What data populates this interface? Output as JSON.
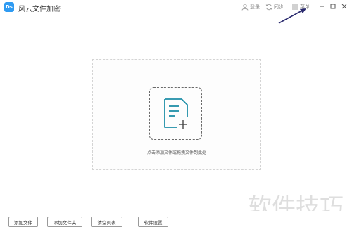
{
  "app": {
    "title": "风云文件加密",
    "logo_text": "Ds"
  },
  "titlebar": {
    "login_label": "登录",
    "sync_label": "同步",
    "menu_label": "菜单"
  },
  "main": {
    "drop_hint": "点击添加文件或拖拽文件到此处"
  },
  "bottom_bar": {
    "add_file": "添加文件",
    "add_folder": "添加文件夹",
    "clear_list": "清空列表",
    "settings": "软件设置"
  },
  "watermark": {
    "text": "软件技巧"
  },
  "icons": {
    "login": "user-icon",
    "sync": "sync-icon",
    "menu": "menu-icon",
    "minimize": "minimize-icon",
    "maximize": "maximize-icon",
    "close": "close-icon",
    "document_add": "document-add-icon"
  },
  "colors": {
    "accent": "#2f9bf2",
    "doc_icon": "#1f8fa8",
    "arrow": "#2a2a6e"
  }
}
